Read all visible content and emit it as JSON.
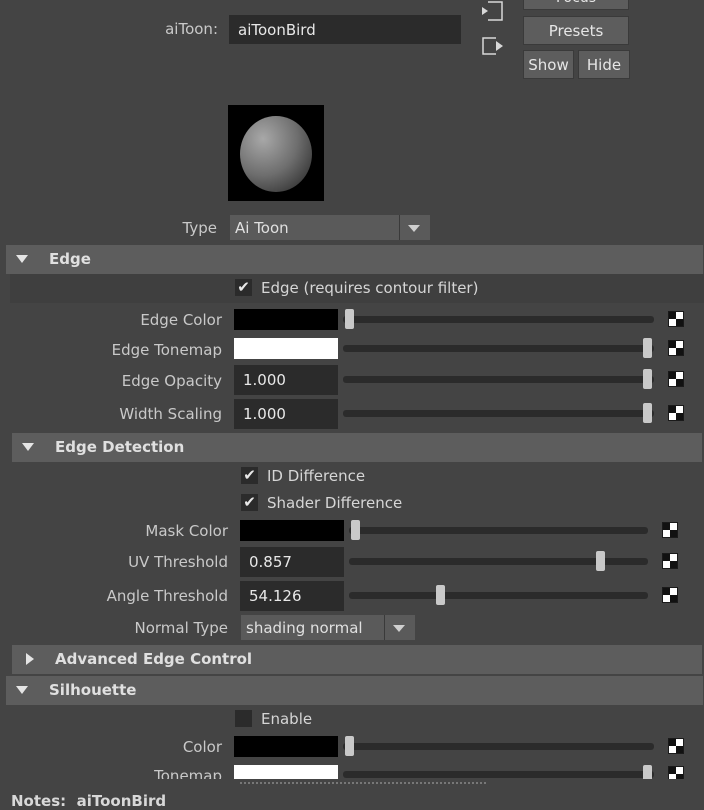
{
  "header": {
    "node_label": "aiToon:",
    "node_name": "aiToonBird",
    "focus_label": "Focus",
    "presets_label": "Presets",
    "show_label": "Show",
    "hide_label": "Hide",
    "type_label": "Type",
    "type_value": "Ai Toon"
  },
  "edge": {
    "title": "Edge",
    "edge_checkbox_label": "Edge (requires contour filter)",
    "edge_checked": true,
    "edge_color": {
      "label": "Edge Color",
      "color": "#000000",
      "level": 0.0
    },
    "edge_tonemap": {
      "label": "Edge Tonemap",
      "color": "#ffffff",
      "level": 1.0
    },
    "edge_opacity": {
      "label": "Edge Opacity",
      "value": "1.000",
      "level": 1.0
    },
    "width_scaling": {
      "label": "Width Scaling",
      "value": "1.000",
      "level": 1.0
    }
  },
  "edge_detection": {
    "title": "Edge Detection",
    "id_difference_label": "ID Difference",
    "id_difference_checked": true,
    "shader_difference_label": "Shader Difference",
    "shader_difference_checked": true,
    "mask_color": {
      "label": "Mask Color",
      "color": "#000000",
      "level": 0.0
    },
    "uv_threshold": {
      "label": "UV Threshold",
      "value": "0.857",
      "level": 0.857
    },
    "angle_threshold": {
      "label": "Angle Threshold",
      "value": "54.126",
      "level": 0.3
    },
    "normal_type_label": "Normal Type",
    "normal_type_value": "shading normal"
  },
  "advanced_edge_control": {
    "title": "Advanced Edge Control"
  },
  "silhouette": {
    "title": "Silhouette",
    "enable_label": "Enable",
    "enable_checked": false,
    "color": {
      "label": "Color",
      "color": "#000000",
      "level": 0.0
    },
    "tonemap": {
      "label": "Tonemap",
      "color": "#ffffff",
      "level": 1.0
    }
  },
  "notes": {
    "label": "Notes:",
    "value": "aiToonBird"
  },
  "colors": {
    "background": "#444444",
    "field": "#2b2b2b",
    "section": "#5d5d5d",
    "button": "#5d5d5d"
  },
  "icons": [
    "input-connection-icon",
    "output-connection-icon",
    "map-button-icon",
    "dropdown-arrow-icon",
    "checkmark-icon",
    "collapse-triangle-icon"
  ]
}
